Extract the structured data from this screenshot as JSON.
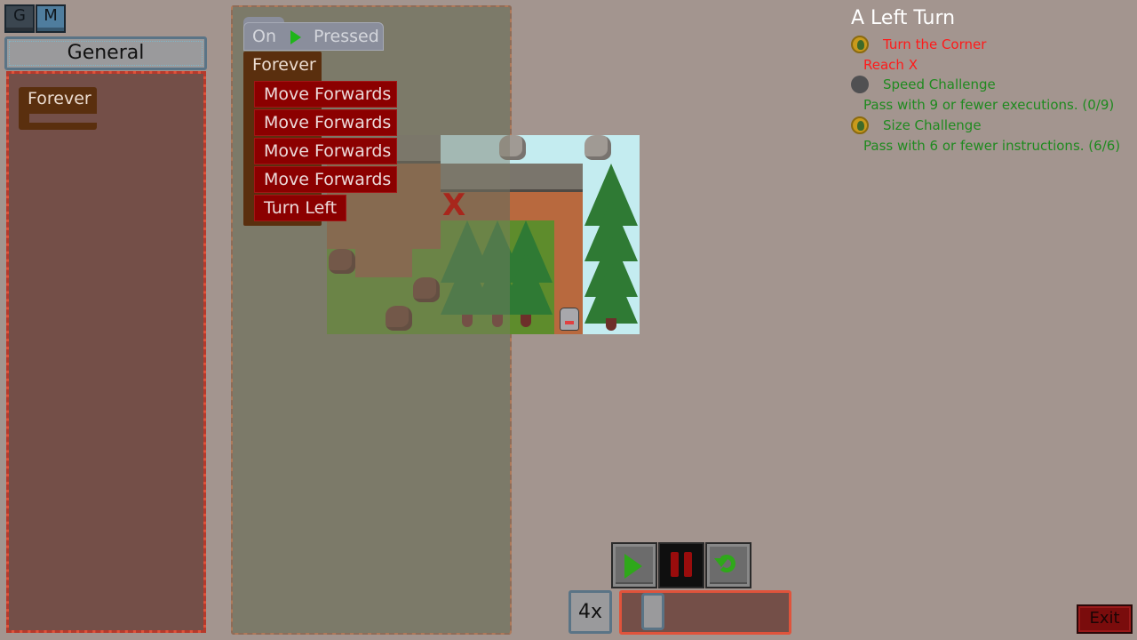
{
  "top_tabs": [
    {
      "label": "G"
    },
    {
      "label": "M"
    }
  ],
  "palette": {
    "header": "General",
    "blocks": [
      {
        "label": "Forever"
      }
    ]
  },
  "script": {
    "event": {
      "prefix": "On",
      "icon": "play-icon",
      "suffix": "Pressed"
    },
    "loop": {
      "label": "Forever"
    },
    "commands": [
      {
        "label": "Move Forwards"
      },
      {
        "label": "Move Forwards"
      },
      {
        "label": "Move Forwards"
      },
      {
        "label": "Move Forwards"
      },
      {
        "label": "Turn Left"
      }
    ]
  },
  "level": {
    "title": "A Left Turn",
    "objectives": [
      {
        "title": "Turn the Corner",
        "description": "Reach X",
        "status": "medal",
        "color": "#ff1a1a"
      },
      {
        "title": "Speed Challenge",
        "description": "Pass with 9 or fewer executions. (0/9)",
        "status": "empty",
        "color": "#1f8a1f"
      },
      {
        "title": "Size Challenge",
        "description": "Pass with 6 or fewer instructions. (6/6)",
        "status": "medal",
        "color": "#1f8a1f"
      }
    ]
  },
  "map": {
    "goal_marker": "X"
  },
  "controls": {
    "play": "play-icon",
    "pause": "pause-icon",
    "reset": "reset-icon",
    "speed_label": "4x",
    "speed_level": 0.0
  },
  "exit_label": "Exit",
  "colors": {
    "background": "#a3958f",
    "command_block": "#8b0000",
    "loop_block": "#5a2f0e",
    "event_block": "#8a8e9c",
    "palette_bg": "#744f48",
    "script_bg": "#7c7a69"
  }
}
